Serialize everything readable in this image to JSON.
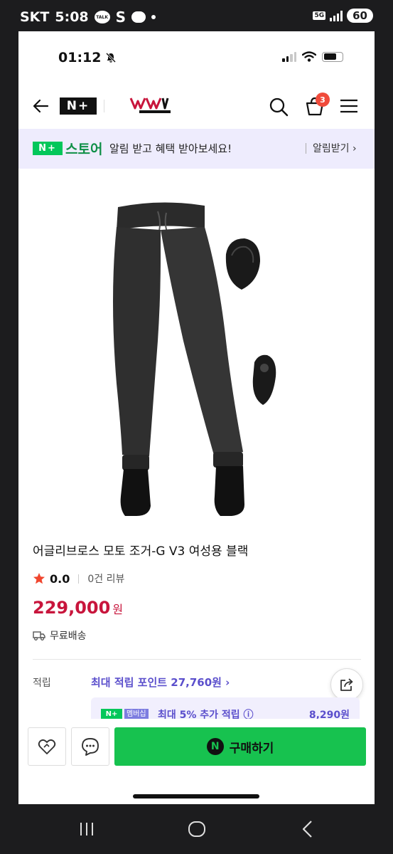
{
  "android_status": {
    "carrier": "SKT",
    "time": "5:08",
    "talk_text": "TALK",
    "s_glyph": "S",
    "net": "5G",
    "battery": "60"
  },
  "ios_status": {
    "time": "01:12"
  },
  "header": {
    "np_logo": "N+",
    "cart_count": "3"
  },
  "banner": {
    "np": "N+",
    "store": "스토어",
    "message": "알림 받고 혜택 받아보세요!",
    "link": "알림받기 ›"
  },
  "product": {
    "name": "어글리브로스 모토 조거-G V3 여성용 블랙",
    "rating": "0.0",
    "reviews": "0건 리뷰",
    "price": "229,000",
    "currency": "원",
    "shipping": "무료배송"
  },
  "points": {
    "label": "적립",
    "link": "최대 적립 포인트 27,760원 ›",
    "member_np": "N+",
    "member_badge": "멤버십",
    "member_text": "최대 5% 추가 적립 ⓘ",
    "member_value": "8,290원"
  },
  "buy_bar": {
    "buy_label": "구매하기",
    "n_glyph": "N"
  },
  "colors": {
    "naver_green": "#03c75a",
    "price_red": "#c8153c",
    "point_purple": "#5b4fcc",
    "banner_bg": "#eeecfd"
  },
  "icons": [
    "back-icon",
    "search-icon",
    "cart-icon",
    "menu-icon",
    "star-icon",
    "truck-icon",
    "share-icon",
    "heart-icon",
    "chat-icon"
  ]
}
